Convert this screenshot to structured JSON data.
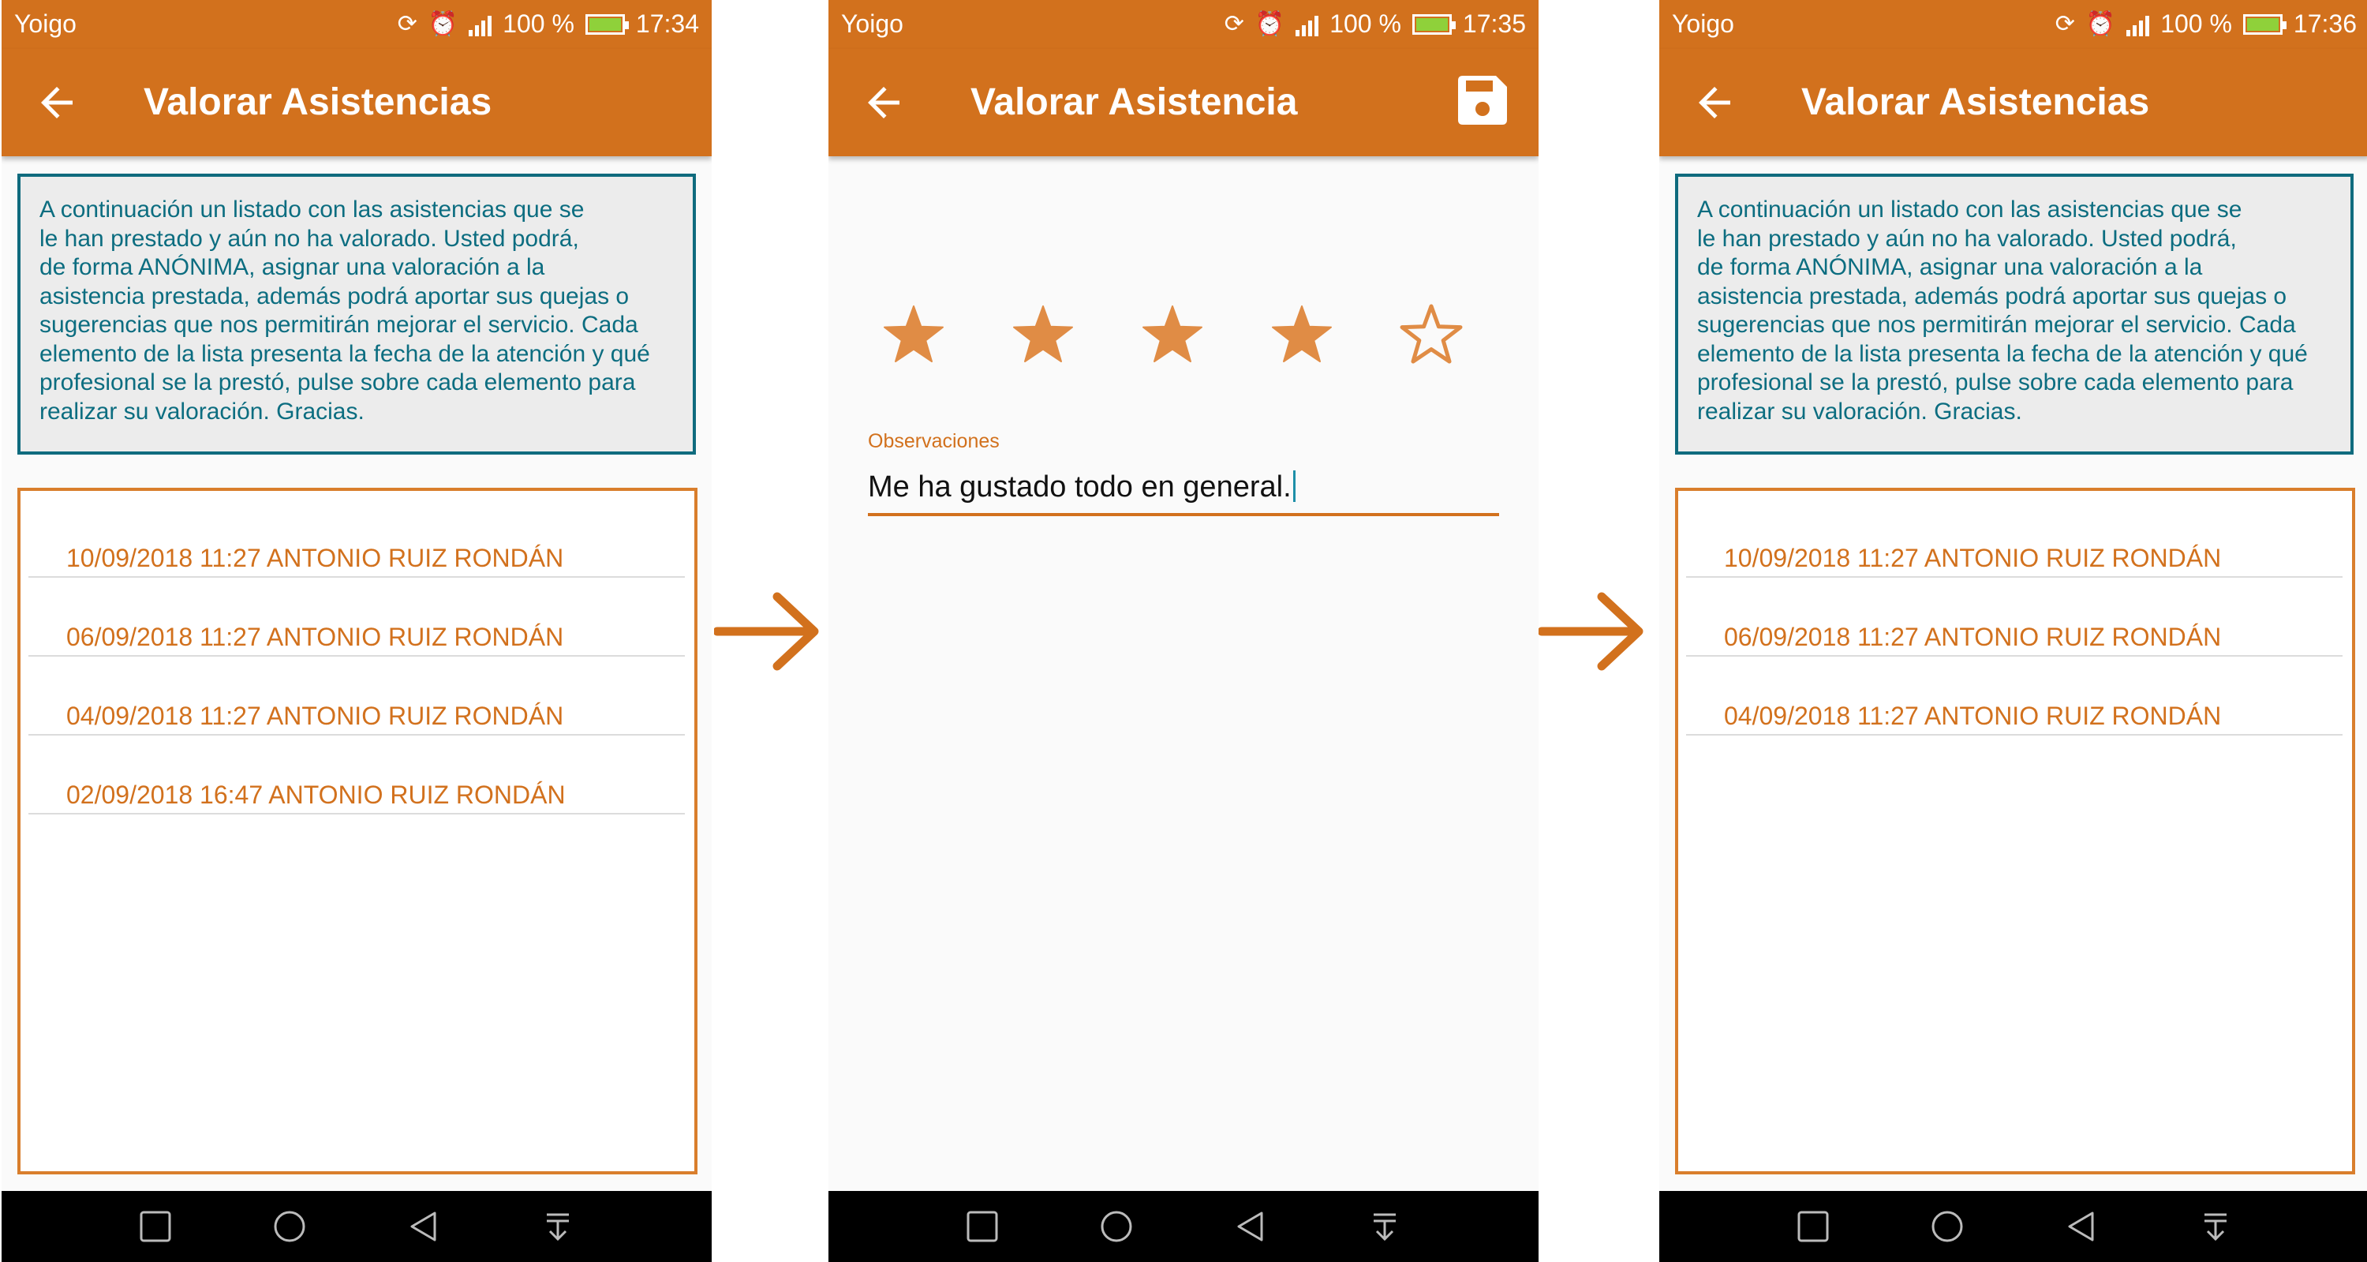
{
  "screens": [
    {
      "status": {
        "carrier": "Yoigo",
        "battery": "100 %",
        "time": "17:34"
      },
      "title": "Valorar Asistencias",
      "info_lines": [
        "A continuación un listado con las asistencias que se",
        "le han prestado y aún no ha valorado. Usted podrá,",
        "de forma ANÓNIMA, asignar una valoración a la",
        "asistencia prestada, además podrá aportar sus quejas o",
        "sugerencias que nos permitirán mejorar el servicio. Cada",
        "elemento de la lista presenta la fecha de la atención y qué",
        "profesional se la prestó, pulse sobre cada elemento para",
        "realizar su valoración. Gracias."
      ],
      "items": [
        "10/09/2018 11:27 ANTONIO RUIZ RONDÁN",
        "06/09/2018 11:27 ANTONIO RUIZ RONDÁN",
        "04/09/2018 11:27 ANTONIO RUIZ RONDÁN",
        "02/09/2018 16:47 ANTONIO RUIZ RONDÁN"
      ]
    },
    {
      "status": {
        "carrier": "Yoigo",
        "battery": "100 %",
        "time": "17:35"
      },
      "title": "Valorar Asistencia",
      "rating": {
        "value": 4,
        "max": 5
      },
      "observations_label": "Observaciones",
      "observations_value": "Me ha gustado todo en general."
    },
    {
      "status": {
        "carrier": "Yoigo",
        "battery": "100 %",
        "time": "17:36"
      },
      "title": "Valorar Asistencias",
      "info_lines": [
        "A continuación un listado con las asistencias que se",
        "le han prestado y aún no ha valorado. Usted podrá,",
        "de forma ANÓNIMA, asignar una valoración a la",
        "asistencia prestada, además podrá aportar sus quejas o",
        "sugerencias que nos permitirán mejorar el servicio. Cada",
        "elemento de la lista presenta la fecha de la atención y qué",
        "profesional se la prestó, pulse sobre cada elemento para",
        "realizar su valoración. Gracias."
      ],
      "items": [
        "10/09/2018 11:27 ANTONIO RUIZ RONDÁN",
        "06/09/2018 11:27 ANTONIO RUIZ RONDÁN",
        "04/09/2018 11:27 ANTONIO RUIZ RONDÁN"
      ]
    }
  ],
  "colors": {
    "primary": "#d2711d",
    "star": "#e08c45",
    "info_text": "#0c6d80",
    "info_border": "#0f6b7e",
    "arrow": "#d2711d"
  },
  "icons": {
    "back": "arrow-left-icon",
    "save": "floppy-disk-icon",
    "star_filled": "star-filled-icon",
    "star_empty": "star-outline-icon",
    "nav": [
      "square-icon",
      "circle-icon",
      "triangle-back-icon",
      "notification-pull-icon"
    ],
    "flow_arrow": "arrow-right-icon"
  }
}
